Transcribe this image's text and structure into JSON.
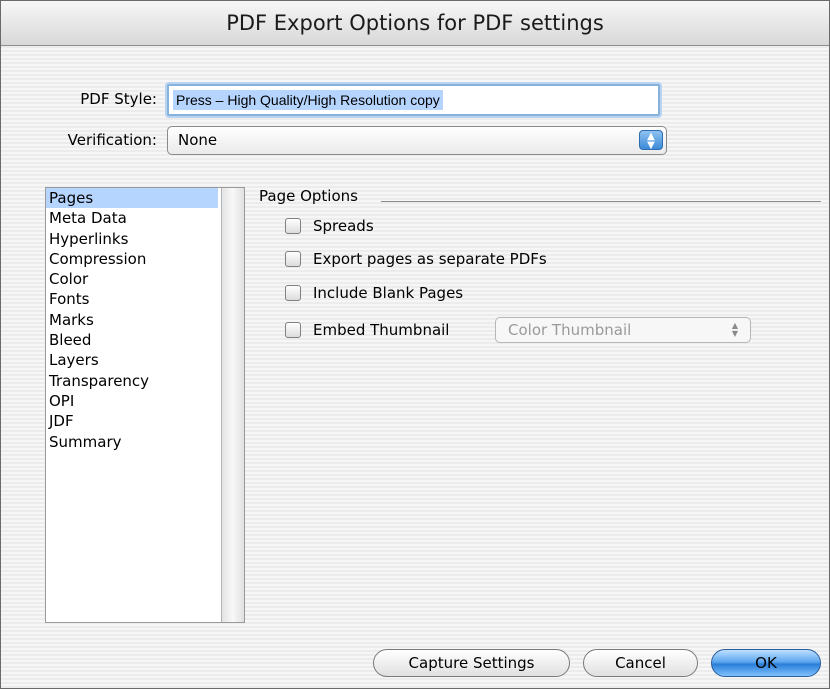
{
  "window": {
    "title": "PDF Export Options for PDF settings"
  },
  "pdf_style": {
    "label": "PDF Style:",
    "value": "Press – High Quality/High Resolution copy"
  },
  "verification": {
    "label": "Verification:",
    "value": "None"
  },
  "sidebar": {
    "items": [
      {
        "label": "Pages",
        "selected": true
      },
      {
        "label": "Meta Data"
      },
      {
        "label": "Hyperlinks"
      },
      {
        "label": "Compression"
      },
      {
        "label": "Color"
      },
      {
        "label": "Fonts"
      },
      {
        "label": "Marks"
      },
      {
        "label": "Bleed"
      },
      {
        "label": "Layers"
      },
      {
        "label": "Transparency"
      },
      {
        "label": "OPI"
      },
      {
        "label": "JDF"
      },
      {
        "label": "Summary"
      }
    ]
  },
  "page_options": {
    "title": "Page Options",
    "checkboxes": [
      {
        "label": "Spreads",
        "checked": false
      },
      {
        "label": "Export pages as separate PDFs",
        "checked": false
      },
      {
        "label": "Include Blank Pages",
        "checked": false
      },
      {
        "label": "Embed Thumbnail",
        "checked": false
      }
    ],
    "thumbnail_select": {
      "value": "Color Thumbnail",
      "disabled": true
    }
  },
  "buttons": {
    "capture": "Capture Settings",
    "cancel": "Cancel",
    "ok": "OK"
  },
  "colors": {
    "selection": "#b5d5ff",
    "accent_blue": "#3c8ad9"
  }
}
